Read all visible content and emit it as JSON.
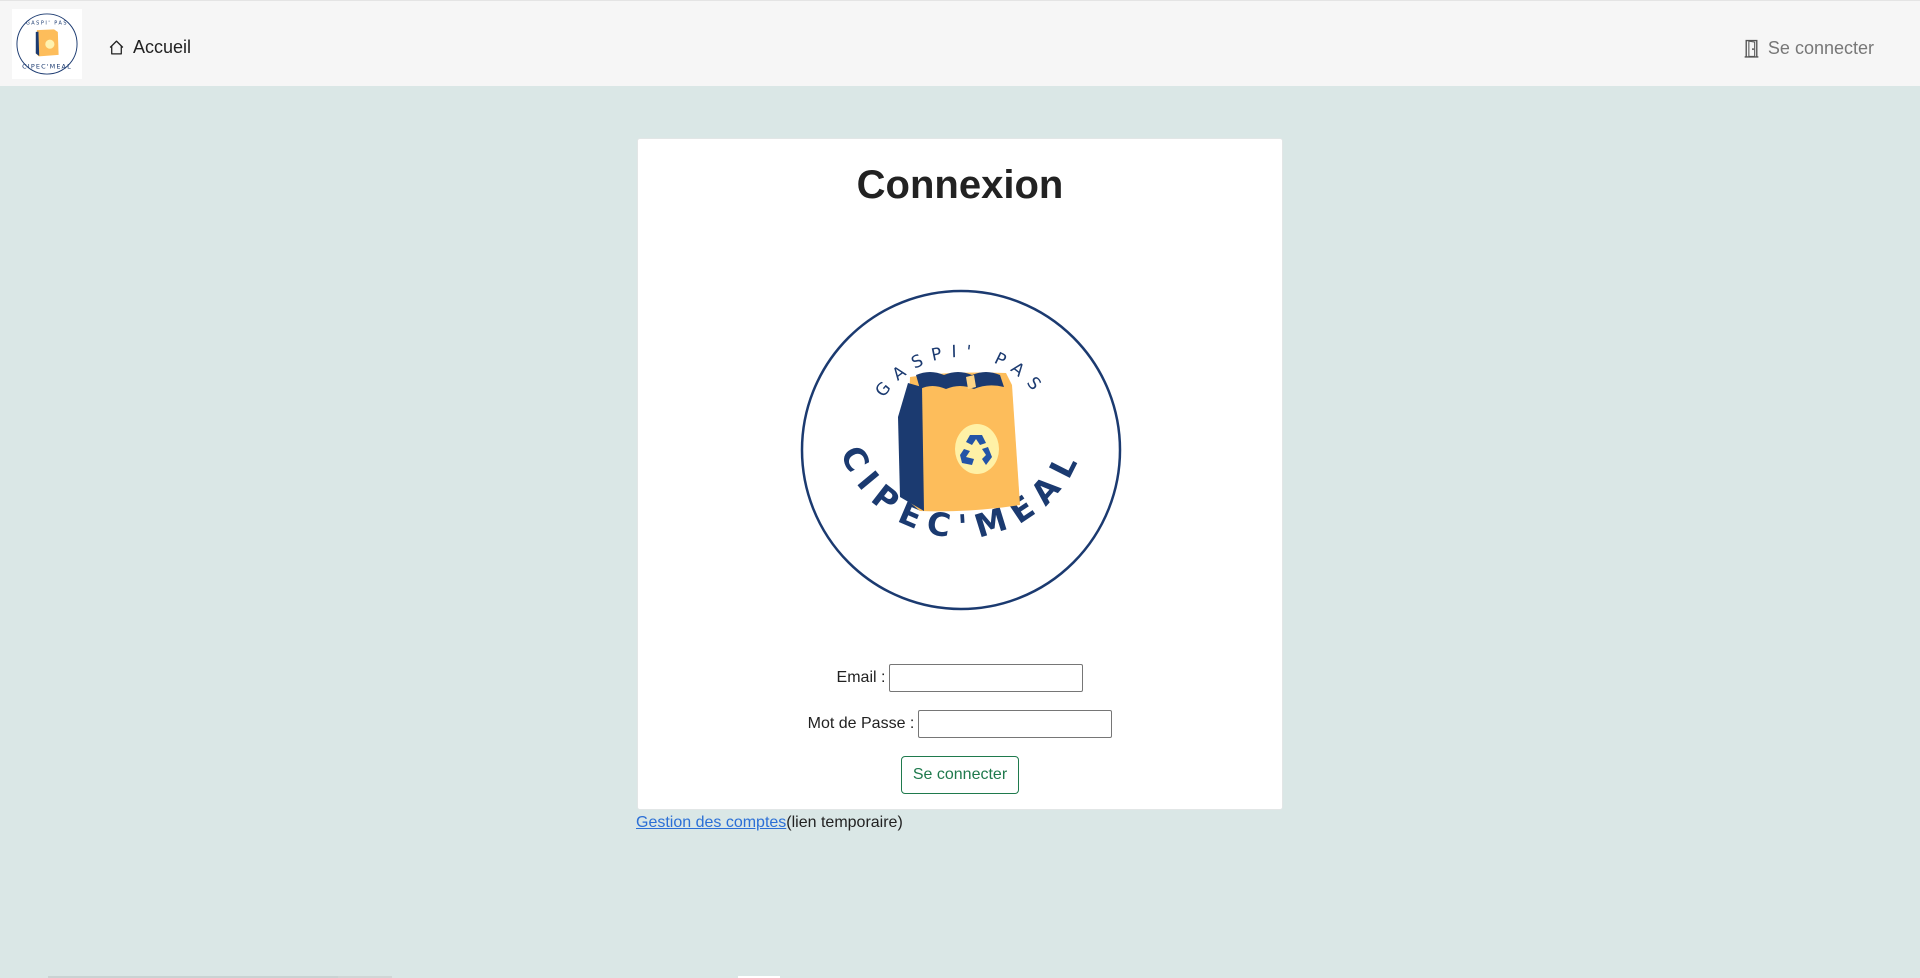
{
  "navbar": {
    "home_label": "Accueil",
    "login_label": "Se connecter"
  },
  "logo": {
    "arc_top": "GASPI' PAS",
    "arc_bottom": "CIPEC'MEAL"
  },
  "card": {
    "title": "Connexion",
    "email_label": "Email :",
    "email_value": "",
    "password_label": "Mot de Passe :",
    "password_value": "",
    "submit_label": "Se connecter"
  },
  "footer": {
    "link_label": "Gestion des comptes",
    "note": "(lien temporaire)"
  },
  "colors": {
    "page_background": "#dae7e6",
    "navbar_background": "#f6f6f6",
    "brand_navy": "#1b3a70",
    "bag_orange": "#fdbd5b",
    "button_green": "#1f7a4d",
    "link_blue": "#2b6fd6"
  },
  "icons": {
    "home": "house-icon",
    "login": "door-icon",
    "recycle": "recycle-icon"
  }
}
